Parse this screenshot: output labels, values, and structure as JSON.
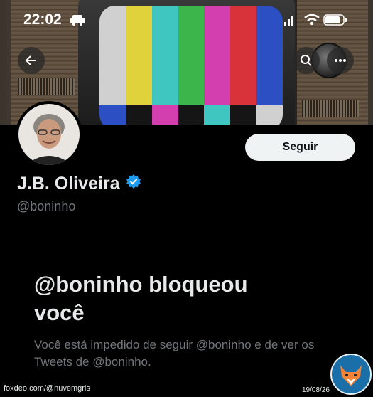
{
  "status_bar": {
    "time": "22:02"
  },
  "profile": {
    "name": "J.B. Oliveira",
    "handle": "@boninho",
    "follow_label": "Seguir",
    "verified_color": "#1d9bf0"
  },
  "blocked": {
    "title_line1": "@boninho bloqueou",
    "title_line2": "você",
    "description": "Você está impedido de seguir @boninho e de ver os Tweets de @boninho."
  },
  "watermark": {
    "left": "foxdeo.com/@nuvemgris",
    "date": "19/08/26"
  },
  "colors": {
    "background": "#000000",
    "text_primary": "#e7e9ea",
    "text_secondary": "#71767b",
    "button_bg": "#eff3f4"
  }
}
